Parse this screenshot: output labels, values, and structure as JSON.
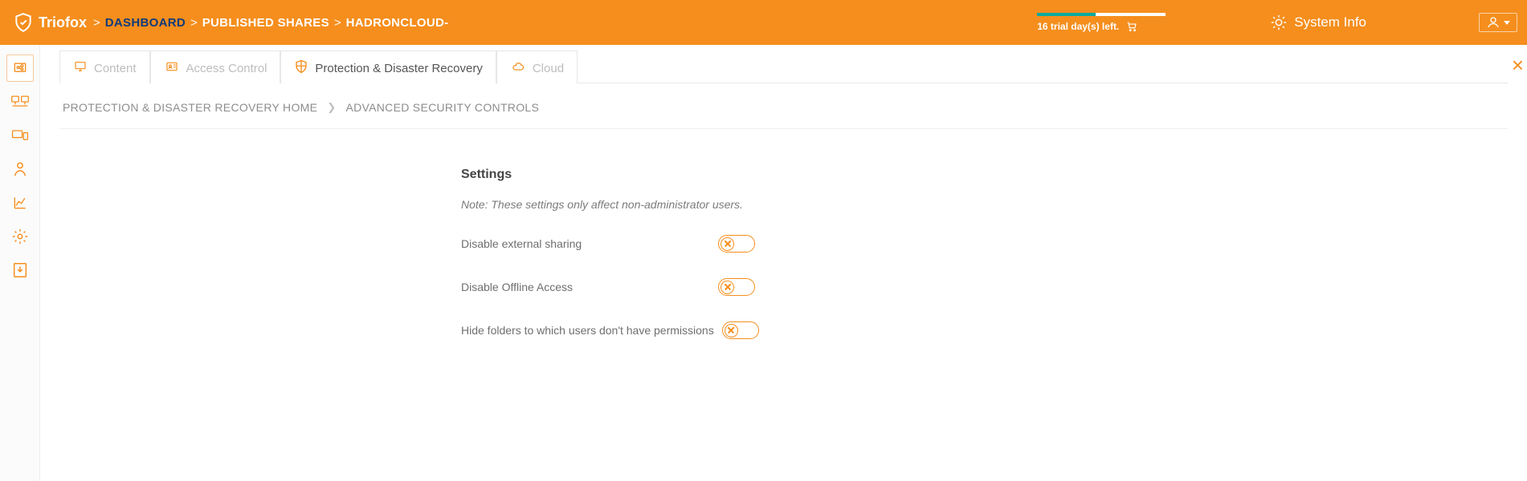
{
  "header": {
    "brand": "Triofox",
    "breadcrumb": {
      "dashboard": "DASHBOARD",
      "published_shares": "PUBLISHED SHARES",
      "current": "HADRONCLOUD-"
    },
    "trial_text": "16 trial day(s) left.",
    "system_info": "System Info"
  },
  "tabs": {
    "content": "Content",
    "access_control": "Access Control",
    "protection": "Protection & Disaster Recovery",
    "cloud": "Cloud"
  },
  "sub_breadcrumb": {
    "home": "PROTECTION & DISASTER RECOVERY HOME",
    "current": "ADVANCED SECURITY CONTROLS"
  },
  "settings": {
    "title": "Settings",
    "note": "Note: These settings only affect non-administrator users.",
    "items": [
      {
        "label": "Disable external sharing"
      },
      {
        "label": "Disable Offline Access"
      },
      {
        "label": "Hide folders to which users don't have permissions"
      }
    ]
  }
}
